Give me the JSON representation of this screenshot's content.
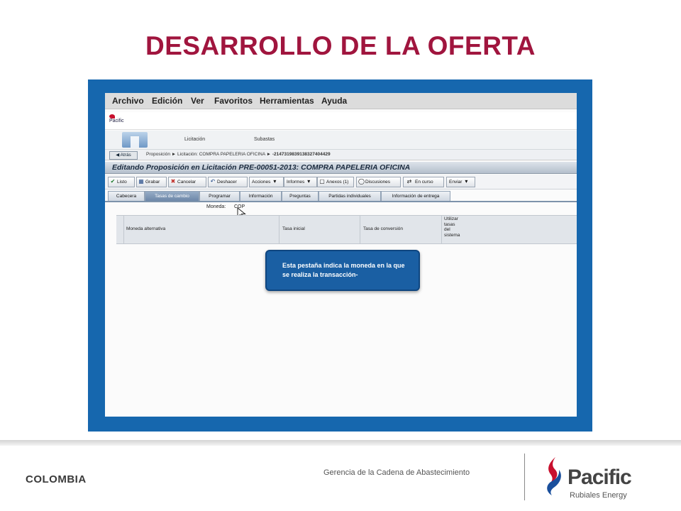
{
  "slide": {
    "title": "DESARROLLO DE LA OFERTA",
    "country": "COLOMBIA",
    "department": "Gerencia de la Cadena de Abastecimiento",
    "brand": {
      "name": "Pacific",
      "tagline": "Rubiales Energy"
    }
  },
  "app": {
    "menu": [
      "Archivo",
      "Edición",
      "Ver",
      "Favoritos",
      "Herramientas",
      "Ayuda"
    ],
    "mini_logo": "Pacific",
    "nav": {
      "licitacion": "Licitación",
      "subastas": "Subastas"
    },
    "back_label": "Atrás",
    "breadcrumb": {
      "proposicion": "Proposición",
      "licitacion": "Licitación: COMPRA PAPELERIA OFICINA",
      "id": "-2147319839138327404429"
    },
    "edit_title": "Editando Proposición en Licitación PRE-00051-2013: COMPRA PAPELERIA OFICINA",
    "toolbar": {
      "listo": "Listo",
      "grabar": "Grabar",
      "cancelar": "Cancelar",
      "deshacer": "Deshacer",
      "acciones": "Acciones",
      "informes": "Informes",
      "anexos": "Anexos (1)",
      "discusiones": "Discusiones",
      "en_curso": "En curso",
      "enviar": "Enviar"
    },
    "tabs": {
      "cabecera": "Cabecera",
      "tasas": "Tasas de cambio",
      "programar": "Programar",
      "informacion": "Información",
      "preguntas": "Preguntas",
      "partidas": "Partidas individuales",
      "entrega": "Información de entrega",
      "active": "Tasas de cambio"
    },
    "moneda": {
      "label": "Moneda:",
      "value": "COP"
    },
    "grid_headers": {
      "moneda_alt": "Moneda alternativa",
      "tasa_inicial": "Tasa inicial",
      "tasa_conversion": "Tasa de conversión",
      "utilizar": [
        "Utilizar",
        "tasas",
        "del",
        "sistema"
      ]
    },
    "tooltip": "Esta pestaña indica la moneda en la que se realiza la transacción-"
  },
  "colors": {
    "title": "#a0153e",
    "frame": "#1667ae",
    "tooltip_bg": "#1a5fa3",
    "brand_red": "#c8102e",
    "brand_blue": "#1a4f9c"
  }
}
